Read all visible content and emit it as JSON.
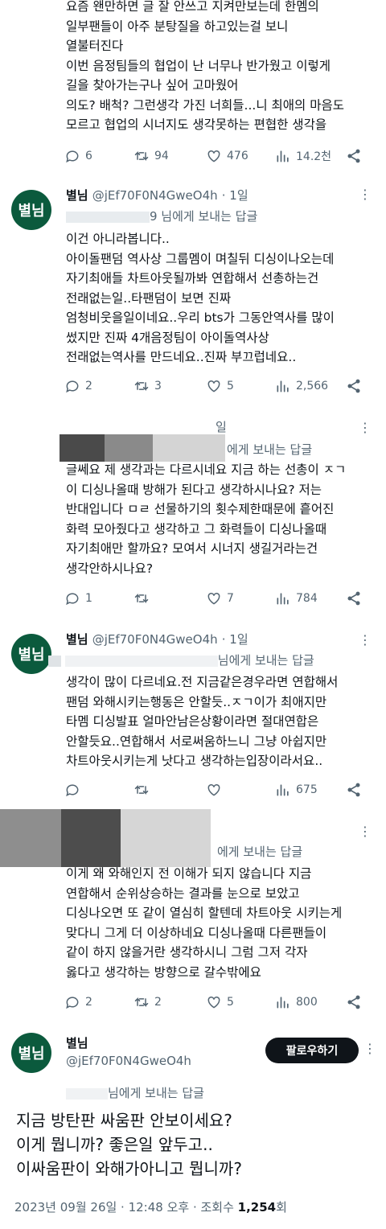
{
  "top_tweet": {
    "lines": [
      "요즘 왠만하면 글 잘 안쓰고 지켜만보는데 한멤의",
      "일부팬들이 아주 분탕질을 하고있는걸 보니",
      "열불터진다",
      "이번 음정팀들의 협업이 난 너무나 반가웠고 이렇게",
      "길을 찾아가는구나 싶어 고마웠어",
      "의도? 배척? 그런생각 가진 너희들...니 최애의 마음도",
      "모르고 협업의 시너지도 생각못하는 편협한 생각을"
    ],
    "replies": "6",
    "retweets": "94",
    "likes": "476",
    "views": "14.2천"
  },
  "reply1": {
    "avatar": "별님",
    "name": "별님",
    "handle": "@jEf70F0N4GweO4h",
    "time": "· 1일",
    "reply_to_suffix": "9 님에게 보내는 답글",
    "lines": [
      "이건 아니라봅니다..",
      "아이돌팬덤 역사상 그룹멤이 며칠뒤 디싱이나오는데",
      "자기최애들 차트아웃될까봐 연합해서 선총하는건",
      "전래없는일..타팬덤이 보면 진짜",
      "엄청비웃을일이네요..우리 bts가 그동안역사를 많이",
      "썼지만 진짜 4개음정팀이 아이돌역사상",
      "전래없는역사를 만드네요..진짜 부끄럽네요.."
    ],
    "replies": "2",
    "retweets": "3",
    "likes": "5",
    "views": "2,566"
  },
  "reply2": {
    "time": "일",
    "reply_to_suffix": "에게 보내는 답글",
    "lines": [
      "글쎄요 제 생각과는 다르시네요 지금 하는 선총이 ㅈㄱ",
      "이 디싱나올때 방해가 된다고 생각하시나요? 저는",
      "반대입니다 ㅁㄹ 선물하기의 횟수제한때문에 흩어진",
      "화력 모아줬다고 생각하고 그 화력들이 디싱나올때",
      "자기최애만 할까요? 모여서 시너지 생길거라는건",
      "생각안하시나요?"
    ],
    "replies": "1",
    "retweets": "",
    "likes": "7",
    "views": "784"
  },
  "reply3": {
    "avatar": "별님",
    "name": "별님",
    "handle": "@jEf70F0N4GweO4h",
    "time": "· 1일",
    "reply_to_suffix": "님에게 보내는 답글",
    "lines": [
      "생각이 많이 다르네요.전 지금같은경우라면 연합해서",
      "팬덤 와해시키는행동은 안할듯..ㅈㄱ이가 최애지만",
      "타멤 디싱발표 얼마안남은상황이라면 절대연합은",
      "안할듯요..연합해서 서로써움하느니  그냥 아쉽지만",
      "차트아웃시키는게 낫다고 생각하는입장이라서요.."
    ],
    "replies": "",
    "retweets": "",
    "likes": "",
    "views": "675"
  },
  "reply4": {
    "reply_to_suffix": "에게 보내는 답글",
    "lines": [
      "이게 왜 와해인지 전 이해가 되지 않습니다 지금",
      "연합해서 순위상승하는 결과를 눈으로 보았고",
      "디싱나오면 또 같이 열심히 할텐데 차트아웃 시키는게",
      "맞다니 그게 더 이상하네요 디싱나올때 다른팬들이",
      "같이 하지 않을거란 생각하시니 그럼 그저 각자",
      "옳다고 생각하는 방향으로 갈수밖에요"
    ],
    "replies": "2",
    "retweets": "2",
    "likes": "5",
    "views": "800"
  },
  "main": {
    "avatar": "별님",
    "name": "별님",
    "handle": "@jEf70F0N4GweO4h",
    "follow_label": "팔로우하기",
    "reply_to_suffix": "님에게 보내는 답글",
    "lines": [
      "지금 방탄판 싸움판 안보이세요?",
      "이게 뭡니까? 좋은일 앞두고..",
      "이싸움판이 와해가아니고 뭡니까?"
    ],
    "meta_prefix": "2023년 09월 26일 · 12:48 오후 · 조회수 ",
    "views_count": "1,254",
    "views_unit": "회"
  },
  "colors": {
    "avatar_bg": "#0b5a3d",
    "muted": "#536471",
    "text": "#0f1419"
  },
  "icons": [
    "reply-icon",
    "retweet-icon",
    "like-icon",
    "views-icon",
    "share-icon",
    "more-icon"
  ]
}
